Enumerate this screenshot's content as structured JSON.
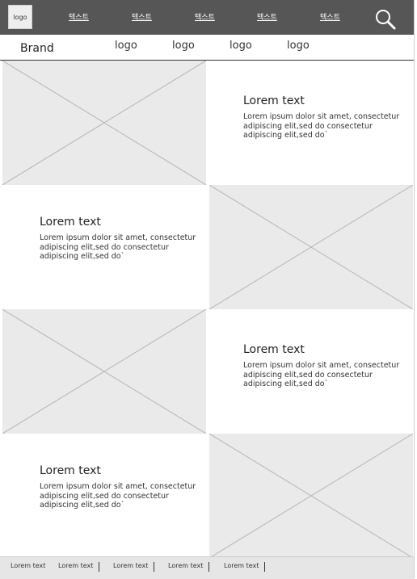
{
  "header": {
    "logo": "logo",
    "nav": [
      "텍스트",
      "텍스트",
      "텍스트",
      "텍스트",
      "텍스트"
    ],
    "search_icon": "search-icon"
  },
  "brandbar": {
    "brand": "Brand",
    "logos": [
      "logo",
      "logo",
      "logo",
      "logo"
    ]
  },
  "rows": [
    {
      "image_side": "left",
      "title": "Lorem text",
      "body": "Lorem ipsum dolor sit amet, consectetur adipiscing elit,sed do consectetur adipiscing elit,sed do`"
    },
    {
      "image_side": "right",
      "title": "Lorem text",
      "body": "Lorem ipsum dolor sit amet, consectetur adipiscing elit,sed do consectetur adipiscing elit,sed do`"
    },
    {
      "image_side": "left",
      "title": "Lorem text",
      "body": "Lorem ipsum dolor sit amet, consectetur adipiscing elit,sed do consectetur adipiscing elit,sed do`"
    },
    {
      "image_side": "right",
      "title": "Lorem text",
      "body": "Lorem ipsum dolor sit amet, consectetur adipiscing elit,sed do consectetur adipiscing elit,sed do`"
    }
  ],
  "footer": {
    "items": [
      "Lorem text",
      "Lorem text",
      "Lorem text",
      "Lorem text",
      "Lorem text"
    ]
  },
  "colors": {
    "topbar": "#565656",
    "placeholder": "#eaeaea",
    "footer": "#e6e6e6"
  }
}
